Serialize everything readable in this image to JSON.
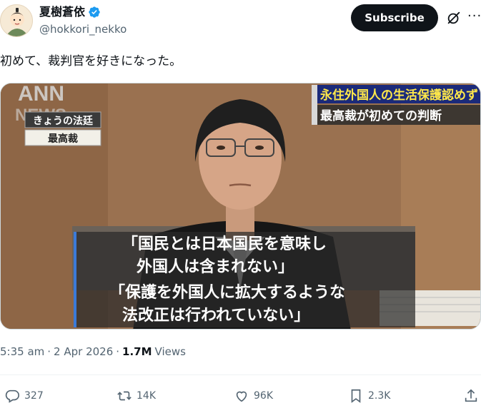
{
  "author": {
    "display_name": "夏樹蒼依",
    "handle": "@hokkori_nekko",
    "verified_color": "#1d9bf0"
  },
  "header": {
    "subscribe_label": "Subscribe",
    "more_label": "···"
  },
  "tweet": {
    "text": "初めて、裁判官を好きになった。"
  },
  "media": {
    "watermark": "ANN",
    "watermark2": "NEWS",
    "program_label": "きょうの法廷",
    "court_label": "最高裁",
    "headline_line1": "永住外国人の生活保護認めず",
    "headline_line2": "最高裁が初めての判断",
    "caption_line1": "「国民とは日本国民を意味し",
    "caption_line2": "外国人は含まれない」",
    "caption_line3": "「保護を外国人に拡大するような",
    "caption_line4": "法改正は行われていない」"
  },
  "meta": {
    "time": "5:35 am",
    "sep1": "·",
    "date": "2 Apr 2026",
    "sep2": "·",
    "views_count": "1.7M",
    "views_label": "Views"
  },
  "actions": {
    "replies": "327",
    "reposts": "14K",
    "likes": "96K",
    "bookmarks": "2.3K"
  },
  "icons": [
    "verified-badge-icon",
    "grok-icon",
    "more-icon",
    "reply-icon",
    "repost-icon",
    "like-icon",
    "bookmark-icon",
    "share-icon"
  ]
}
